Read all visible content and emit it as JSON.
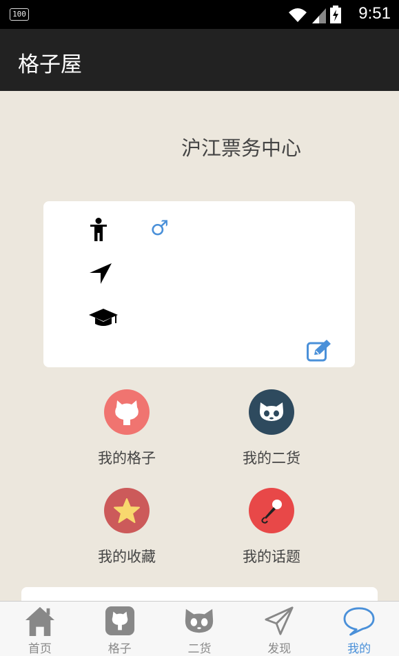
{
  "status_bar": {
    "battery": "100",
    "time": "9:51"
  },
  "app_bar": {
    "title": "格子屋"
  },
  "profile": {
    "username": "沪江票务中心",
    "gender_symbol": "♂"
  },
  "menu": [
    {
      "label": "我的格子",
      "icon": "github-cat-icon",
      "color": "#f07470"
    },
    {
      "label": "我的二货",
      "icon": "cat-face-icon",
      "color": "#2e4a5e"
    },
    {
      "label": "我的收藏",
      "icon": "star-icon",
      "color": "#cc5a5a"
    },
    {
      "label": "我的话题",
      "icon": "microphone-icon",
      "color": "#e84848"
    }
  ],
  "tabs": [
    {
      "label": "首页",
      "icon": "home-icon",
      "active": false
    },
    {
      "label": "格子",
      "icon": "github-icon",
      "active": false
    },
    {
      "label": "二货",
      "icon": "cat-face-icon",
      "active": false
    },
    {
      "label": "发现",
      "icon": "paper-plane-icon",
      "active": false
    },
    {
      "label": "我的",
      "icon": "chat-bubble-icon",
      "active": true
    }
  ],
  "colors": {
    "accent": "#4a90d9",
    "app_bar": "#222222",
    "background": "#ece7dd"
  }
}
